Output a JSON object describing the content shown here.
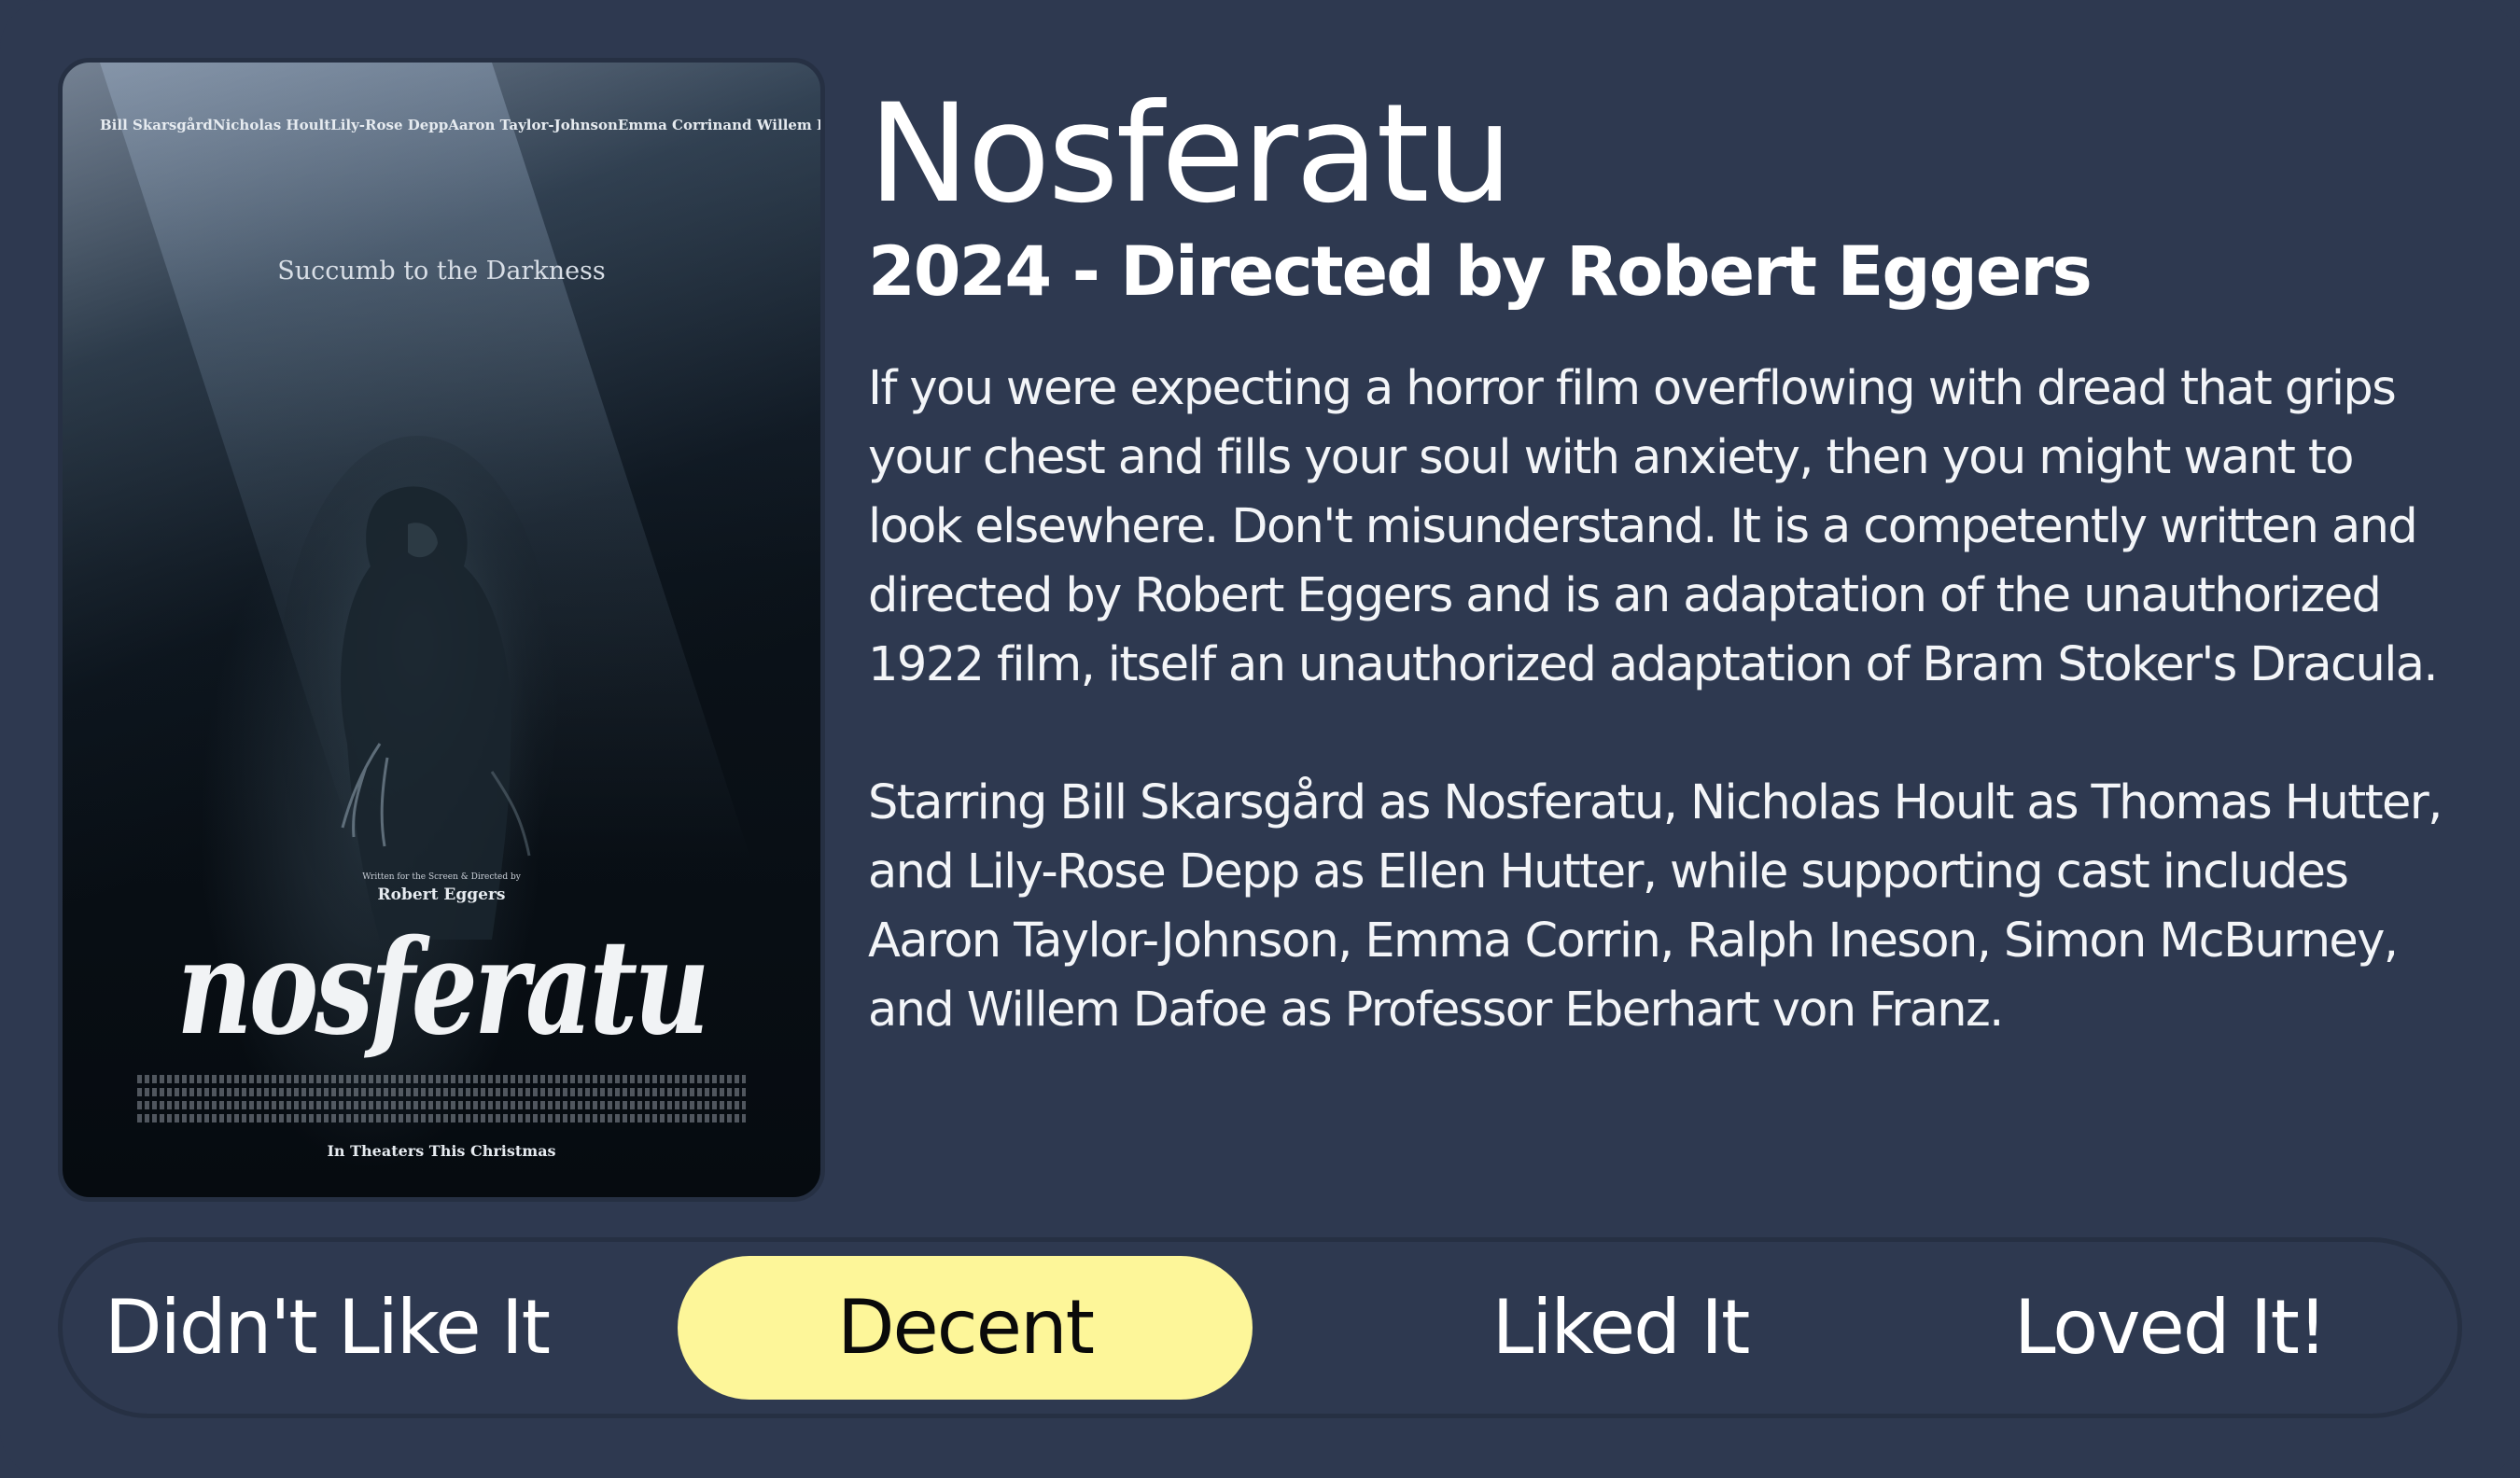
{
  "movie": {
    "title": "Nosferatu",
    "subtitle": "2024 - Directed by Robert Eggers",
    "review_paragraphs": [
      "If you were expecting a horror film overflowing with dread that grips your chest and fills your soul with anxiety, then you might want to look elsewhere. Don't misunderstand. It is a competently written and directed by Robert Eggers and is an adaptation of the unauthorized 1922 film, itself an unauthorized adaptation of Bram Stoker's Dracula.",
      "Starring Bill Skarsgård as Nosferatu, Nicholas Hoult as Thomas Hutter, and Lily-Rose Depp as Ellen Hutter, while supporting cast includes Aaron Taylor-Johnson, Emma Corrin, Ralph Ineson, Simon McBurney, and Willem Dafoe as Professor Eberhart von Franz."
    ]
  },
  "poster": {
    "cast": [
      "Bill Skarsgård",
      "Nicholas Hoult",
      "Lily-Rose Depp",
      "Aaron Taylor-Johnson",
      "Emma Corrin",
      "and Willem Dafoe"
    ],
    "tagline": "Succumb to the Darkness",
    "credit_small": "Written for the Screen & Directed by",
    "director": "Robert Eggers",
    "logo": "nosferatu",
    "release": "In Theaters This Christmas"
  },
  "rating": {
    "options": [
      {
        "label": "Didn't Like It",
        "selected": false
      },
      {
        "label": "Decent",
        "selected": true
      },
      {
        "label": "Liked It",
        "selected": false
      },
      {
        "label": "Loved It!",
        "selected": false
      }
    ],
    "selected_color": "#fdf699"
  },
  "colors": {
    "background": "#2e3950",
    "border": "#263043",
    "text": "#ffffff"
  }
}
